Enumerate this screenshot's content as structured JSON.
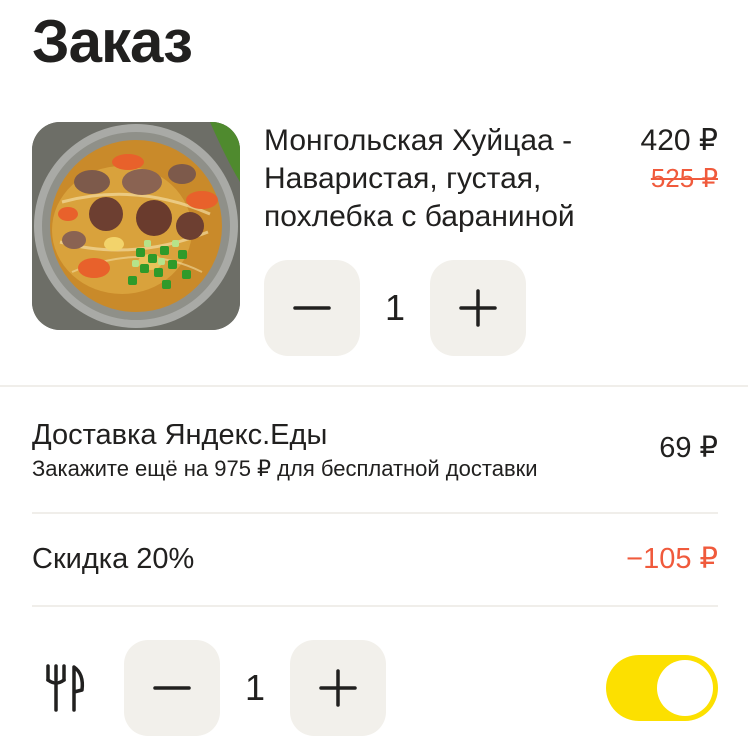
{
  "header": {
    "title": "Заказ"
  },
  "item": {
    "image_icon": "food-photo",
    "name_line1": "Монгольская Хуйцаа -",
    "name_line2": "Наваристая, густая,",
    "name_line3": "похлебка с бараниной",
    "price": "420 ₽",
    "old_price": "525 ₽",
    "quantity": "1"
  },
  "delivery": {
    "title": "Доставка Яндекс.Еды",
    "hint": "Закажите ещё на 975 ₽ для бесплатной доставки",
    "price": "69 ₽"
  },
  "discount": {
    "label": "Скидка 20%",
    "value": "−105 ₽"
  },
  "cutlery": {
    "icon": "cutlery-icon",
    "quantity": "1",
    "toggle_on": true
  },
  "colors": {
    "accent": "#fce000",
    "discount": "#f05a3c",
    "button_bg": "#f2f0eb",
    "text": "#21201f"
  }
}
